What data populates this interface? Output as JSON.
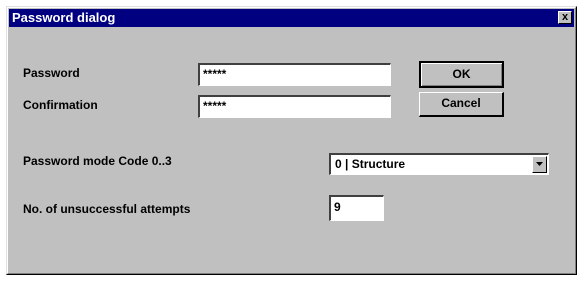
{
  "window": {
    "title": "Password dialog",
    "close_glyph": "x"
  },
  "password": {
    "label": "Password",
    "value": "*****"
  },
  "confirmation": {
    "label": "Confirmation",
    "value": "*****"
  },
  "buttons": {
    "ok": "OK",
    "cancel": "Cancel"
  },
  "mode": {
    "label": "Password mode Code 0..3",
    "selected": "0 | Structure"
  },
  "attempts": {
    "label": "No. of unsuccessful attempts",
    "value": "9"
  },
  "icons": {
    "dropdown": "chevron-down-icon",
    "close": "close-icon"
  },
  "colors": {
    "titlebar": "#000080",
    "face": "#c0c0c0"
  }
}
